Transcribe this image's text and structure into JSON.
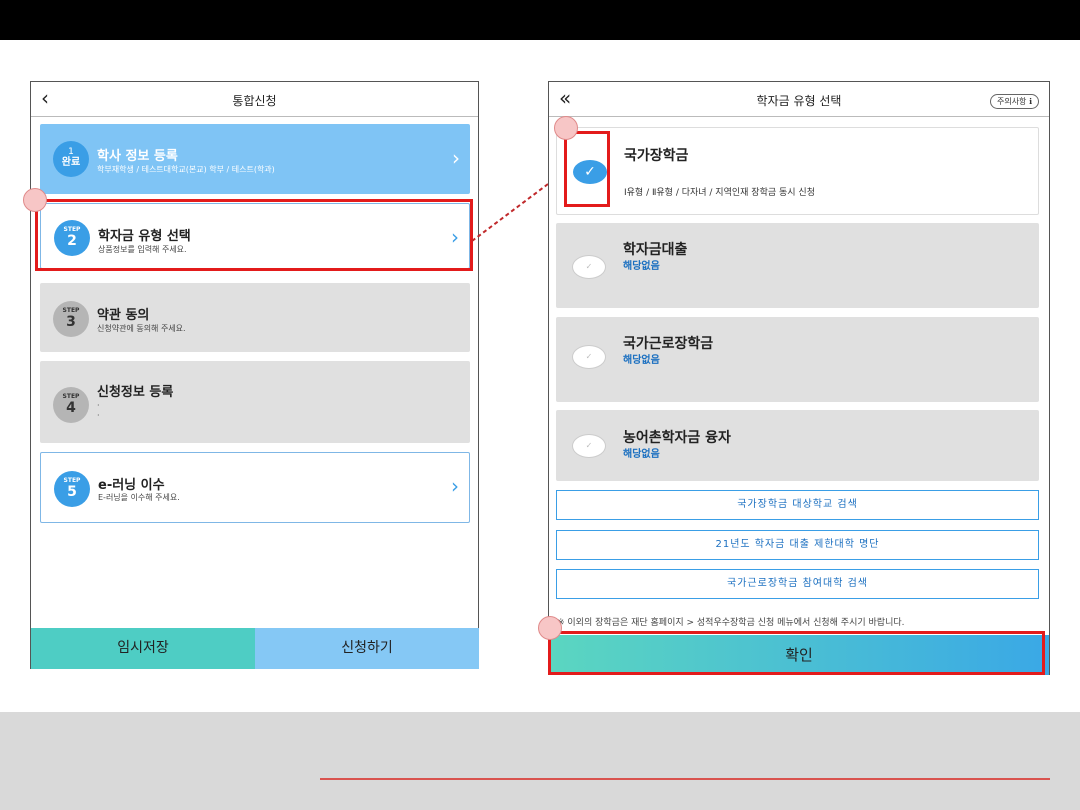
{
  "left": {
    "title": "통합신청",
    "steps": [
      {
        "badge_top": "1",
        "badge_main": "완료",
        "title": "학사 정보 등록",
        "sub": "학부재학생 / 테스트대학교(본교) 학부 / 테스트(학과)"
      },
      {
        "badge_top": "STEP",
        "badge_main": "2",
        "title": "학자금 유형 선택",
        "sub": "상품정보를 입력해 주세요."
      },
      {
        "badge_top": "STEP",
        "badge_main": "3",
        "title": "약관 동의",
        "sub": "신청약관에 동의해 주세요."
      },
      {
        "badge_top": "STEP",
        "badge_main": "4",
        "title": "신청정보 등록",
        "sub": "·",
        "sub2": "·"
      },
      {
        "badge_top": "STEP",
        "badge_main": "5",
        "title": "e-러닝 이수",
        "sub": "E-러닝을 이수해 주세요."
      }
    ],
    "save_label": "임시저장",
    "apply_label": "신청하기"
  },
  "right": {
    "title": "학자금 유형 선택",
    "notice_label": "주의사항 ℹ",
    "cards": [
      {
        "title": "국가장학금",
        "desc": "Ⅰ유형 / Ⅱ유형 / 다자녀 / 지역인재 장학금 동시 신청",
        "checked": true
      },
      {
        "title": "학자금대출",
        "status": "해당없음",
        "checked": false
      },
      {
        "title": "국가근로장학금",
        "status": "해당없음",
        "checked": false
      },
      {
        "title": "농어촌학자금 융자",
        "status": "해당없음",
        "checked": false
      }
    ],
    "links": [
      "국가장학금 대상학교 검색",
      "21년도 학자금 대출 제한대학 명단",
      "국가근로장학금 참여대학 검색"
    ],
    "footnote": "※ 이외의 장학금은 재단 홈페이지 > 성적우수장학금 신청 메뉴에서 신청해 주시기 바랍니다.",
    "confirm_label": "확인"
  },
  "colors": {
    "accent": "#3a9ee6",
    "highlight": "#e31b1b",
    "teal": "#4ecdc4"
  }
}
